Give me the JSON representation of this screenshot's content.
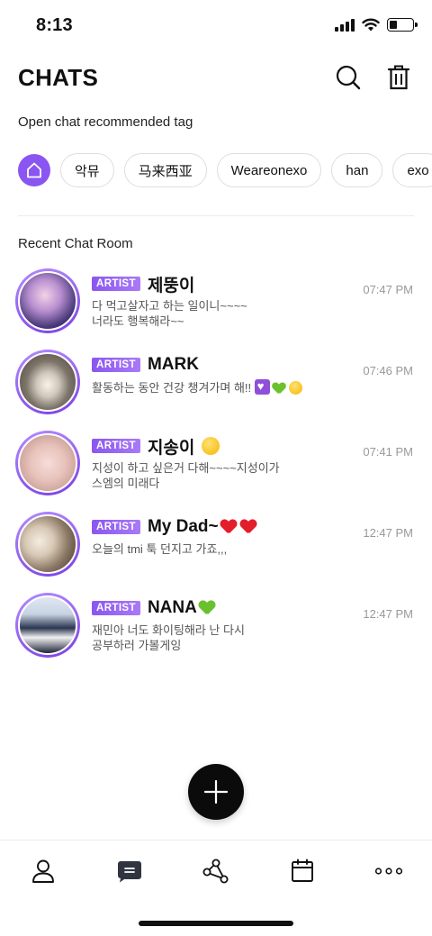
{
  "status_bar": {
    "time": "8:13"
  },
  "header": {
    "title": "CHATS"
  },
  "tags": {
    "label": "Open chat recommended tag",
    "items": [
      "악뮤",
      "马来西亚",
      "Weareonexo",
      "han",
      "exo"
    ]
  },
  "recent": {
    "label": "Recent Chat Room",
    "badge": "ARTIST",
    "chats": [
      {
        "name": "제뚱이",
        "preview1": "다 먹고살자고 하는 일이니~~~~",
        "preview2": "너라도 행복해라~~",
        "time": "07:47 PM"
      },
      {
        "name": "MARK",
        "preview1": "활동하는 동안 건강 챙겨가며 해!!",
        "preview2": "",
        "time": "07:46 PM"
      },
      {
        "name": "지송이",
        "preview1": "지성이 하고 싶은거 다해~~~~지성이가",
        "preview2": "스엠의 미래다",
        "time": "07:41 PM"
      },
      {
        "name": "My Dad~",
        "preview1": "오늘의 tmi 툭 던지고 가죠,,,",
        "preview2": "",
        "time": "12:47 PM"
      },
      {
        "name": "NANA",
        "preview1": "재민아 너도 화이팅해라 난 다시",
        "preview2": "공부하러 가볼게잉",
        "time": "12:47 PM"
      }
    ]
  },
  "colors": {
    "accent": "#8b55f2",
    "badge_end": "#a97af7",
    "fab": "#0b0b0b",
    "heart_red": "#e31d2a",
    "heart_green": "#6ac12e"
  },
  "icons": [
    "search-icon",
    "trash-icon",
    "home-icon",
    "plus-icon",
    "profile-icon",
    "chat-icon",
    "share-network-icon",
    "calendar-icon",
    "more-icon"
  ]
}
